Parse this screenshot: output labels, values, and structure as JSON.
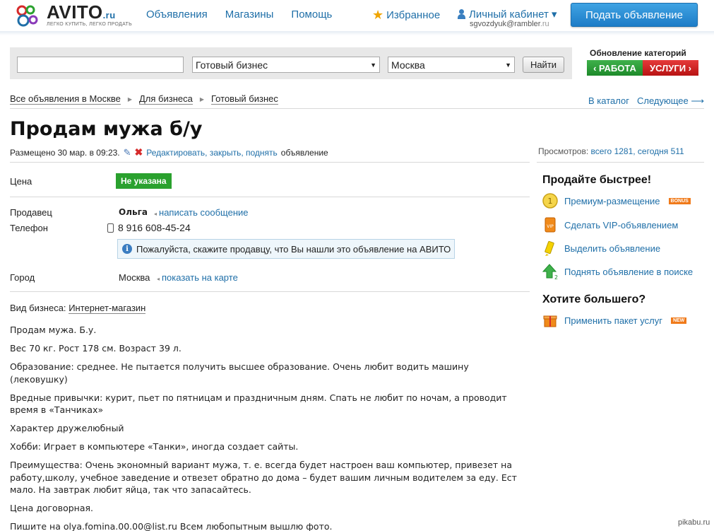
{
  "header": {
    "logo_text": "AVITO",
    "logo_domain": ".ru",
    "logo_tagline": "ЛЕГКО КУПИТЬ, ЛЕГКО ПРОДАТЬ",
    "nav": [
      "Объявления",
      "Магазины",
      "Помощь"
    ],
    "favorites": "Избранное",
    "cabinet": "Личный кабинет ▾",
    "email_user": "sgvozdyuk@rambler",
    "email_domain": ".ru",
    "post_button": "Подать объявление"
  },
  "search": {
    "query_value": "",
    "category": "Готовый бизнес",
    "city": "Москва",
    "find_button": "Найти"
  },
  "promo": {
    "title": "Обновление категорий",
    "work": "‹ РАБОТА",
    "services": "УСЛУГИ ›"
  },
  "breadcrumb": [
    "Все объявления в Москве",
    "Для бизнеса",
    "Готовый бизнес"
  ],
  "nav_links": {
    "catalog": "В каталог",
    "next": "Следующее ⟶"
  },
  "ad": {
    "title": "Продам мужа б/у",
    "posted": "Размещено 30 мар. в 09:23.",
    "edit_link": "Редактировать, закрыть, поднять",
    "edit_suffix": "объявление",
    "views_label": "Просмотров:",
    "views_value": "всего 1281, сегодня 511",
    "price_label": "Цена",
    "price_value": "Не указана",
    "seller_label": "Продавец",
    "seller_name": "Ольга",
    "write_message": "написать сообщение",
    "phone_label": "Телефон",
    "phone_value": "8 916 608-45-24",
    "notice": "Пожалуйста, скажите продавцу, что Вы нашли это объявление на АВИТО",
    "city_label": "Город",
    "city_value": "Москва",
    "map_link": "показать на карте",
    "biz_label": "Вид бизнеса:",
    "biz_value": "Интернет-магазин",
    "description": [
      "Продам мужа. Б.у.",
      "Вес 70 кг. Рост 178 см. Возраст 39 л.",
      "Образование: среднее. Не пытается получить высшее образование. Очень любит водить машину (лековушку)",
      "Вредные привычки: курит, пьет по пятницам и праздничным дням. Спать не любит по ночам, а проводит время в «Танчиках»",
      "Характер дружелюбный",
      "Хобби: Играет в компьютере «Танки», иногда создает сайты.",
      "Преимущества: Очень экономный вариант мужа, т. е. всегда будет настроен ваш компьютер, привезет на работу,школу, учебное заведение и отвезет обратно до дома – будет вашим личным водителем за еду. Ест мало. На завтрак любит яйца, так что запасайтесь.",
      "Цена договорная.",
      "Пишите на olya.fomina.00.00@list.ru Всем любопытным вышлю фото."
    ]
  },
  "sidebar": {
    "sell_faster": "Продайте быстрее!",
    "premium": "Премиум-размещение",
    "premium_badge": "BONUS",
    "vip": "Сделать VIP-объявлением",
    "highlight": "Выделить объявление",
    "raise": "Поднять объявление в поиске",
    "want_more": "Хотите большего?",
    "package": "Применить пакет услуг",
    "package_badge": "NEW"
  },
  "watermark": "pikabu.ru",
  "colors": {
    "link": "#1f6fa8",
    "price_badge": "#2aa12e",
    "post_button": "#1d7cc7",
    "work_tag": "#1d8a2a",
    "services_tag": "#b81313"
  }
}
